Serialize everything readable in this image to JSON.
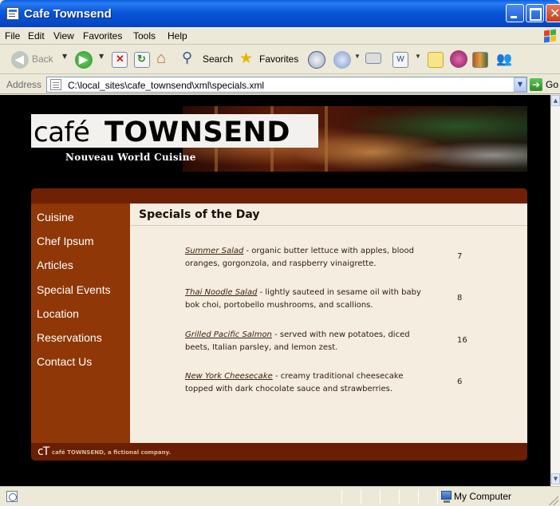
{
  "window": {
    "title": "Cafe Townsend",
    "icon": "ie-page-icon"
  },
  "menu": [
    "File",
    "Edit",
    "View",
    "Favorites",
    "Tools",
    "Help"
  ],
  "toolbar": {
    "back_label": "Back",
    "search_label": "Search",
    "favorites_label": "Favorites"
  },
  "address": {
    "label": "Address",
    "value": "C:\\local_sites\\cafe_townsend\\xml\\specials.xml",
    "go_label": "Go"
  },
  "site": {
    "logo_cafe": "café",
    "logo_townsend": "TOWNSEND",
    "tagline": "Nouveau World Cuisine",
    "nav": [
      "Cuisine",
      "Chef Ipsum",
      "Articles",
      "Special Events",
      "Location",
      "Reservations",
      "Contact Us"
    ],
    "content_title": "Specials of the Day",
    "specials": [
      {
        "name": "Summer Salad",
        "description": " - organic butter lettuce with apples, blood oranges, gorgonzola, and raspberry vinaigrette.",
        "price": "7"
      },
      {
        "name": "Thai Noodle Salad",
        "description": " - lightly sauteed in sesame oil with baby bok choi, portobello mushrooms, and scallions.",
        "price": "8"
      },
      {
        "name": "Grilled Pacific Salmon",
        "description": " - served with new potatoes, diced beets, Italian parsley, and lemon zest.",
        "price": "16"
      },
      {
        "name": "New York Cheesecake",
        "description": " - creamy traditional cheesecake topped with dark chocolate sauce and strawberries.",
        "price": "6"
      }
    ],
    "footer_mark": "cT",
    "footer_text": "café TOWNSEND, a fictional company."
  },
  "status": {
    "zone": "My Computer"
  }
}
